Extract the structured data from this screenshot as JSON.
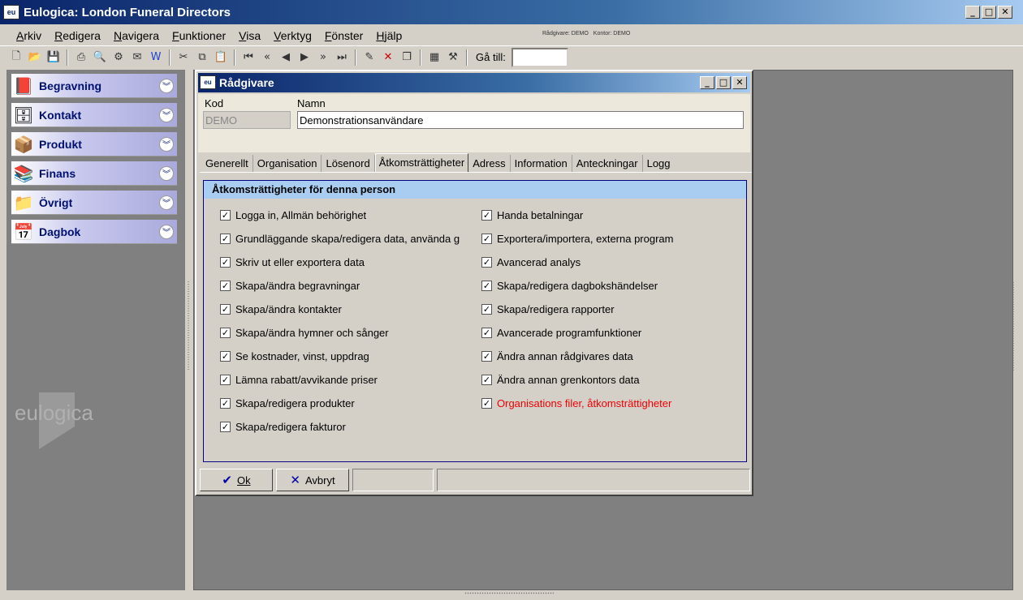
{
  "window": {
    "title": "Eulogica: London Funeral Directors",
    "icon_text": "eu"
  },
  "menu": [
    "Arkiv",
    "Redigera",
    "Navigera",
    "Funktioner",
    "Visa",
    "Verktyg",
    "Fönster",
    "Hjälp"
  ],
  "status": {
    "radgivare": "Rådgivare: DEMO",
    "kontor": "Kontor: DEMO"
  },
  "toolbar": {
    "goto_label": "Gå till:",
    "goto_value": ""
  },
  "nav": [
    {
      "label": "Begravning",
      "icon": "book-icon"
    },
    {
      "label": "Kontakt",
      "icon": "cabinet-icon"
    },
    {
      "label": "Produkt",
      "icon": "box-icon"
    },
    {
      "label": "Finans",
      "icon": "books-icon"
    },
    {
      "label": "Övrigt",
      "icon": "folder-question-icon"
    },
    {
      "label": "Dagbok",
      "icon": "calendar-icon"
    }
  ],
  "logo_text": "eulogica",
  "dialog": {
    "title": "Rådgivare",
    "kod_label": "Kod",
    "kod_value": "DEMO",
    "namn_label": "Namn",
    "namn_value": "Demonstrationsanvändare",
    "tabs": [
      "Generellt",
      "Organisation",
      "Lösenord",
      "Åtkomsträttigheter",
      "Adress",
      "Information",
      "Anteckningar",
      "Logg"
    ],
    "active_tab": "Åtkomsträttigheter",
    "panel_title": "Åtkomsträttigheter för denna person",
    "left_checks": [
      "Logga in, Allmän behörighet",
      "Grundläggande skapa/redigera data, använda g",
      "Skriv ut eller exportera data",
      "Skapa/ändra begravningar",
      "Skapa/ändra kontakter",
      "Skapa/ändra hymner och sånger",
      "Se kostnader, vinst, uppdrag",
      "Lämna rabatt/avvikande priser",
      "Skapa/redigera produkter",
      "Skapa/redigera fakturor"
    ],
    "right_checks": [
      "Handa betalningar",
      "Exportera/importera, externa program",
      "Avancerad analys",
      "Skapa/redigera dagbokshändelser",
      "Skapa/redigera rapporter",
      "Avancerade programfunktioner",
      "Ändra annan rådgivares data",
      "Ändra annan grenkontors data",
      "Organisations filer, åtkomsträttigheter"
    ],
    "ok_label": "Ok",
    "cancel_label": "Avbryt"
  },
  "colors": {
    "title_dark": "#0a246a",
    "panel_head": "#a8cdf0",
    "red_text": "#e00000"
  }
}
